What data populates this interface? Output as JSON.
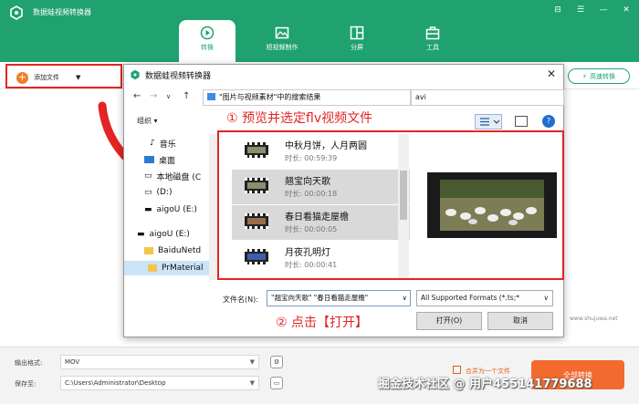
{
  "app": {
    "title": "数据蛙视频转换器"
  },
  "window_controls": [
    "⊟",
    "☰",
    "—",
    "✕"
  ],
  "nav_tabs": [
    {
      "label": "转换",
      "active": true
    },
    {
      "label": "短视频制作"
    },
    {
      "label": "分屏"
    },
    {
      "label": "工具"
    }
  ],
  "toolbar": {
    "add_file": "添加文件",
    "convert_all_top": "高速转换"
  },
  "dialog": {
    "title": "数据蛙视频转换器",
    "address": "\"图片与视频素材\"中的搜索结果",
    "search_value": "avi",
    "organize": "组织 ▾",
    "nav_items": [
      {
        "label": "音乐"
      },
      {
        "label": "桌面"
      },
      {
        "label": "本地磁盘 (C"
      },
      {
        "label": "(D:)"
      },
      {
        "label": "aigoU (E:)"
      },
      {
        "label": "aigoU (E:)"
      },
      {
        "label": "BaiduNetd"
      },
      {
        "label": "PrMaterial"
      }
    ],
    "files": [
      {
        "name": "中秋月饼，人月两圆",
        "duration": "时长: 00:59:39"
      },
      {
        "name": "翘宝向天歌",
        "duration": "时长: 00:00:18"
      },
      {
        "name": "春日看猫走屋檐",
        "duration": "时长: 00:00:05"
      },
      {
        "name": "月夜孔明灯",
        "duration": "时长: 00:00:41"
      }
    ],
    "filename_label": "文件名(N):",
    "filename_value": "\"翘宝向天歌\" \"春日看猫走屋檐\"",
    "filetype": "All Supported Formats (*.ts;*",
    "open_label": "打开(O)",
    "cancel_label": "取消"
  },
  "annotations": {
    "step1": "① 预览并选定flv视频文件",
    "step2": "② 点击【打开】"
  },
  "bottom": {
    "format_label": "输出格式:",
    "format_value": "MOV",
    "save_label": "保存至:",
    "save_path": "C:\\Users\\Administrator\\Desktop",
    "merge_label": "合并为一个文件",
    "convert_all": "全部转换"
  },
  "watermark": "掘金技术社区 @ 用户45514177968​8",
  "site_watermark": "www.shujuwa.net",
  "colors": {
    "brand": "#1fa26f",
    "accent": "#f26a2e",
    "annotation": "#e32424"
  }
}
